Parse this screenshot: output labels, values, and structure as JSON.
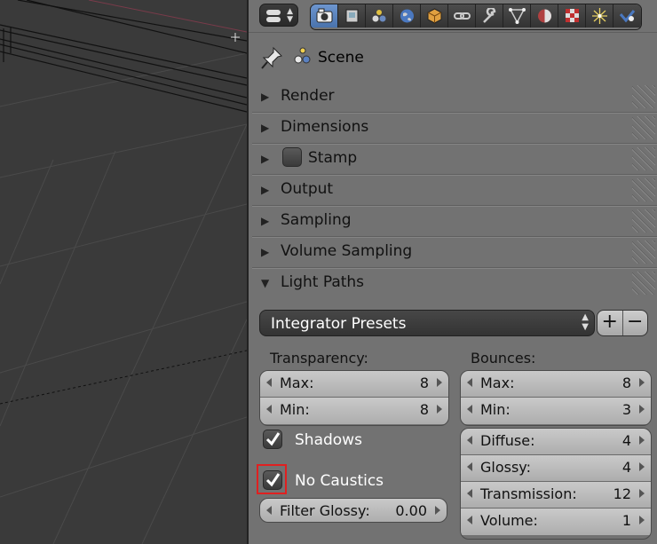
{
  "panel": {
    "context": {
      "label": "Scene"
    },
    "tabs": [
      "render-icon",
      "render-layers-icon",
      "scene-icon",
      "world-icon",
      "object-icon",
      "constraints-icon",
      "modifiers-icon",
      "data-icon",
      "material-icon",
      "texture-icon",
      "particles-icon",
      "physics-icon"
    ],
    "sections": [
      {
        "label": "Render"
      },
      {
        "label": "Dimensions"
      },
      {
        "label": "Stamp"
      },
      {
        "label": "Output"
      },
      {
        "label": "Sampling"
      },
      {
        "label": "Volume Sampling"
      },
      {
        "label": "Light Paths"
      }
    ],
    "light_paths": {
      "preset_label": "Integrator Presets",
      "transparency": {
        "heading": "Transparency:",
        "max_label": "Max:",
        "max_value": "8",
        "min_label": "Min:",
        "min_value": "8"
      },
      "bounces": {
        "heading": "Bounces:",
        "max_label": "Max:",
        "max_value": "8",
        "min_label": "Min:",
        "min_value": "3",
        "diffuse_label": "Diffuse:",
        "diffuse_value": "4",
        "glossy_label": "Glossy:",
        "glossy_value": "4",
        "transmission_label": "Transmission:",
        "transmission_value": "12",
        "volume_label": "Volume:",
        "volume_value": "1"
      },
      "shadows_label": "Shadows",
      "shadows_checked": true,
      "no_caustics_label": "No Caustics",
      "no_caustics_checked": true,
      "filter_glossy_label": "Filter Glossy:",
      "filter_glossy_value": "0.00"
    }
  },
  "colors": {
    "panel_bg": "#727272",
    "active_tab": "#5a84c0",
    "highlight": "#e02020"
  }
}
